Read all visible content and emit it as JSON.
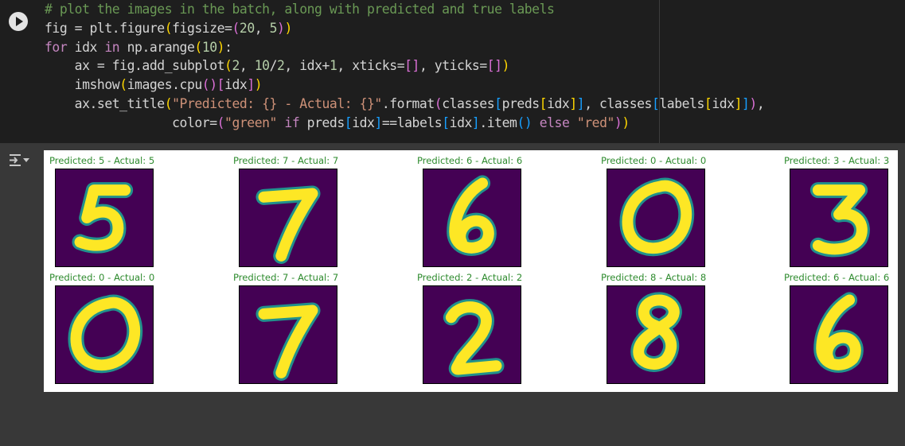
{
  "code_lines": [
    [
      {
        "t": "# plot the images in the batch, along with predicted and true labels",
        "c": "c-com"
      }
    ],
    [
      {
        "t": "fig = plt.figure"
      },
      {
        "t": "(",
        "c": "c-br1"
      },
      {
        "t": "figsize="
      },
      {
        "t": "(",
        "c": "c-br2"
      },
      {
        "t": "20",
        "c": "c-num"
      },
      {
        "t": ", "
      },
      {
        "t": "5",
        "c": "c-num"
      },
      {
        "t": ")",
        "c": "c-br2"
      },
      {
        "t": ")",
        "c": "c-br1"
      }
    ],
    [
      {
        "t": "for",
        "c": "c-kw"
      },
      {
        "t": " idx "
      },
      {
        "t": "in",
        "c": "c-kw"
      },
      {
        "t": " np.arange"
      },
      {
        "t": "(",
        "c": "c-br1"
      },
      {
        "t": "10",
        "c": "c-num"
      },
      {
        "t": ")",
        "c": "c-br1"
      },
      {
        "t": ":"
      }
    ],
    [
      {
        "t": "    ax = fig.add_subplot"
      },
      {
        "t": "(",
        "c": "c-br1"
      },
      {
        "t": "2",
        "c": "c-num"
      },
      {
        "t": ", "
      },
      {
        "t": "10",
        "c": "c-num"
      },
      {
        "t": "/"
      },
      {
        "t": "2",
        "c": "c-num"
      },
      {
        "t": ", idx+"
      },
      {
        "t": "1",
        "c": "c-num"
      },
      {
        "t": ", xticks="
      },
      {
        "t": "[]",
        "c": "c-br2"
      },
      {
        "t": ", yticks="
      },
      {
        "t": "[]",
        "c": "c-br2"
      },
      {
        "t": ")",
        "c": "c-br1"
      }
    ],
    [
      {
        "t": "    imshow"
      },
      {
        "t": "(",
        "c": "c-br1"
      },
      {
        "t": "images.cpu"
      },
      {
        "t": "()",
        "c": "c-br2"
      },
      {
        "t": "[",
        "c": "c-br2"
      },
      {
        "t": "idx"
      },
      {
        "t": "]",
        "c": "c-br2"
      },
      {
        "t": ")",
        "c": "c-br1"
      }
    ],
    [
      {
        "t": "    ax.set_title"
      },
      {
        "t": "(",
        "c": "c-br1"
      },
      {
        "t": "\"Predicted: {} - Actual: {}\"",
        "c": "c-str"
      },
      {
        "t": ".format"
      },
      {
        "t": "(",
        "c": "c-br2"
      },
      {
        "t": "classes"
      },
      {
        "t": "[",
        "c": "c-br3"
      },
      {
        "t": "preds"
      },
      {
        "t": "[",
        "c": "c-br1"
      },
      {
        "t": "idx"
      },
      {
        "t": "]",
        "c": "c-br1"
      },
      {
        "t": "]",
        "c": "c-br3"
      },
      {
        "t": ", classes"
      },
      {
        "t": "[",
        "c": "c-br3"
      },
      {
        "t": "labels"
      },
      {
        "t": "[",
        "c": "c-br1"
      },
      {
        "t": "idx"
      },
      {
        "t": "]",
        "c": "c-br1"
      },
      {
        "t": "]",
        "c": "c-br3"
      },
      {
        "t": ")",
        "c": "c-br2"
      },
      {
        "t": ","
      }
    ],
    [
      {
        "t": "                 color="
      },
      {
        "t": "(",
        "c": "c-br2"
      },
      {
        "t": "\"green\"",
        "c": "c-str"
      },
      {
        "t": " "
      },
      {
        "t": "if",
        "c": "c-kw"
      },
      {
        "t": " preds"
      },
      {
        "t": "[",
        "c": "c-br3"
      },
      {
        "t": "idx"
      },
      {
        "t": "]",
        "c": "c-br3"
      },
      {
        "t": "==labels"
      },
      {
        "t": "[",
        "c": "c-br3"
      },
      {
        "t": "idx"
      },
      {
        "t": "]",
        "c": "c-br3"
      },
      {
        "t": ".item"
      },
      {
        "t": "()",
        "c": "c-br3"
      },
      {
        "t": " "
      },
      {
        "t": "else",
        "c": "c-kw"
      },
      {
        "t": " "
      },
      {
        "t": "\"red\"",
        "c": "c-str"
      },
      {
        "t": ")",
        "c": "c-br2"
      },
      {
        "t": ")",
        "c": "c-br1"
      }
    ]
  ],
  "icons": {
    "run": "play-icon",
    "output_toggle": "output-collapse-icon"
  },
  "colors": {
    "title_correct": "#2e8b2e",
    "image_background": "#440154",
    "digit_stroke": "#fde725",
    "digit_edge": "#21918c"
  },
  "panels": [
    {
      "title": "Predicted: 5 - Actual: 5",
      "digit": "5"
    },
    {
      "title": "Predicted: 7 - Actual: 7",
      "digit": "7"
    },
    {
      "title": "Predicted: 6 - Actual: 6",
      "digit": "6"
    },
    {
      "title": "Predicted: 0 - Actual: 0",
      "digit": "0"
    },
    {
      "title": "Predicted: 3 - Actual: 3",
      "digit": "3"
    },
    {
      "title": "Predicted: 0 - Actual: 0",
      "digit": "0"
    },
    {
      "title": "Predicted: 7 - Actual: 7",
      "digit": "7"
    },
    {
      "title": "Predicted: 2 - Actual: 2",
      "digit": "2"
    },
    {
      "title": "Predicted: 8 - Actual: 8",
      "digit": "8"
    },
    {
      "title": "Predicted: 6 - Actual: 6",
      "digit": "6"
    }
  ]
}
